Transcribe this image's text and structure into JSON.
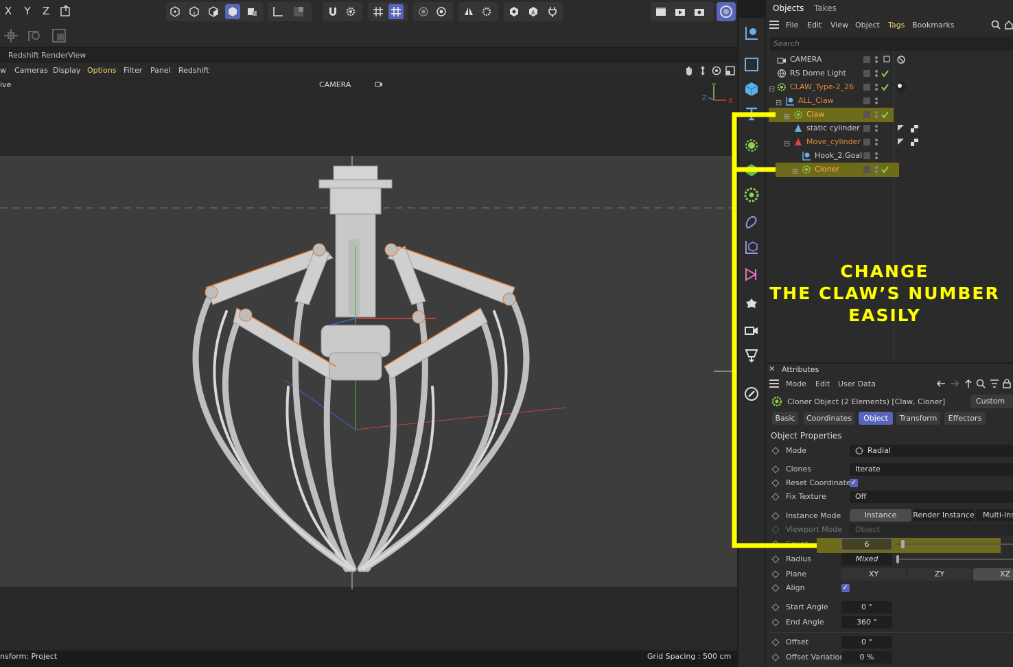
{
  "toolbar": {
    "axes": [
      "X",
      "Y",
      "Z"
    ]
  },
  "renderview": {
    "title": "Redshift RenderView",
    "menu": [
      "w",
      "Cameras",
      "Display",
      "Options",
      "Filter",
      "Panel",
      "Redshift"
    ],
    "mode_label": "ive",
    "camera_label": "CAMERA"
  },
  "viewport": {
    "status_left": "nsform: Project",
    "status_right": "Grid Spacing : 500 cm",
    "gizmo_axes": [
      "Y",
      "Z",
      "X"
    ]
  },
  "objects_panel": {
    "tabs": [
      "Objects",
      "Takes"
    ],
    "menu": [
      "File",
      "Edit",
      "View",
      "Object",
      "Tags",
      "Bookmarks"
    ],
    "search_placeholder": "Search",
    "tree": [
      {
        "name": "CAMERA",
        "color": "#cfcfcf"
      },
      {
        "name": "RS Dome Light",
        "color": "#cfcfcf"
      },
      {
        "name": "CLAW_Type-2_26",
        "color": "#e08a3c"
      },
      {
        "name": "ALL_Claw",
        "color": "#e08a3c"
      },
      {
        "name": "Claw",
        "color": "#ffb347"
      },
      {
        "name": "static cylinder",
        "color": "#cfcfcf"
      },
      {
        "name": "Move_cylinder",
        "color": "#e08a3c"
      },
      {
        "name": "Hook_2.Goal",
        "color": "#cfcfcf"
      },
      {
        "name": "Cloner",
        "color": "#ffb347"
      }
    ]
  },
  "annotation": {
    "lines": [
      "CHANGE",
      "THE CLAW’S NUMBER",
      "EASILY"
    ]
  },
  "attributes": {
    "title": "Attributes",
    "menu": [
      "Mode",
      "Edit",
      "User Data"
    ],
    "object_title": "Cloner Object (2 Elements) [Claw, Cloner]",
    "preset": "Custom",
    "tabs": [
      "Basic",
      "Coordinates",
      "Object",
      "Transform",
      "Effectors"
    ],
    "section": "Object Properties",
    "fields": {
      "mode_label": "Mode",
      "mode_value": "Radial",
      "clones_label": "Clones",
      "clones_value": "Iterate",
      "reset_label": "Reset Coordinates",
      "fix_texture_label": "Fix Texture",
      "fix_texture_value": "Off",
      "instance_mode_label": "Instance Mode",
      "instance_options": [
        "Instance",
        "Render Instance",
        "Multi-Ins"
      ],
      "viewport_mode_label": "Viewport Mode",
      "viewport_mode_value": "Object",
      "count_label": "Count",
      "count_value": "6",
      "radius_label": "Radius",
      "radius_value": "Mixed",
      "plane_label": "Plane",
      "plane_options": [
        "XY",
        "ZY",
        "XZ"
      ],
      "align_label": "Align",
      "start_angle_label": "Start Angle",
      "start_angle_value": "0 °",
      "end_angle_label": "End Angle",
      "end_angle_value": "360 °",
      "offset_label": "Offset",
      "offset_value": "0 °",
      "offset_var_label": "Offset Variation",
      "offset_var_value": "0 %"
    }
  },
  "colors": {
    "accent": "#5865b8",
    "highlight": "#ffff00",
    "check": "#8fd14f"
  }
}
